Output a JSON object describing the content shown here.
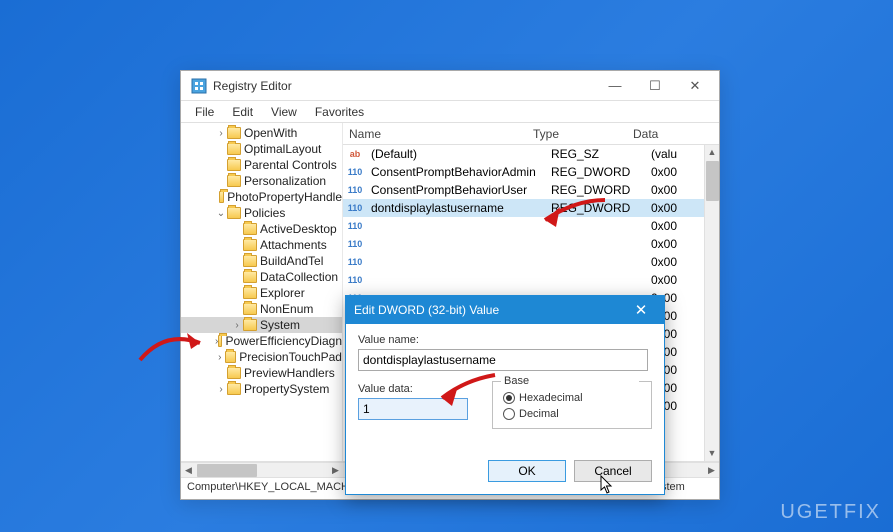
{
  "window": {
    "title": "Registry Editor",
    "menu": [
      "File",
      "Edit",
      "View",
      "Favorites"
    ],
    "status_path": "Computer\\HKEY_LOCAL_MACHINE\\SOFTWARE\\Microsoft\\Windows\\CurrentVersion\\Policies\\System"
  },
  "tree": {
    "items": [
      {
        "label": "OpenWith",
        "indent": 34,
        "arrow": ">"
      },
      {
        "label": "OptimalLayout",
        "indent": 34,
        "arrow": ""
      },
      {
        "label": "Parental Controls",
        "indent": 34,
        "arrow": ""
      },
      {
        "label": "Personalization",
        "indent": 34,
        "arrow": ""
      },
      {
        "label": "PhotoPropertyHandle",
        "indent": 34,
        "arrow": ""
      },
      {
        "label": "Policies",
        "indent": 34,
        "arrow": "v",
        "expanded": true
      },
      {
        "label": "ActiveDesktop",
        "indent": 50,
        "arrow": ""
      },
      {
        "label": "Attachments",
        "indent": 50,
        "arrow": ""
      },
      {
        "label": "BuildAndTel",
        "indent": 50,
        "arrow": ""
      },
      {
        "label": "DataCollection",
        "indent": 50,
        "arrow": ""
      },
      {
        "label": "Explorer",
        "indent": 50,
        "arrow": ""
      },
      {
        "label": "NonEnum",
        "indent": 50,
        "arrow": ""
      },
      {
        "label": "System",
        "indent": 50,
        "arrow": ">",
        "selected": true
      },
      {
        "label": "PowerEfficiencyDiagn",
        "indent": 34,
        "arrow": ">"
      },
      {
        "label": "PrecisionTouchPad",
        "indent": 34,
        "arrow": ">"
      },
      {
        "label": "PreviewHandlers",
        "indent": 34,
        "arrow": ""
      },
      {
        "label": "PropertySystem",
        "indent": 34,
        "arrow": ">"
      }
    ]
  },
  "list": {
    "headers": {
      "name": "Name",
      "type": "Type",
      "data": "Data"
    },
    "rows": [
      {
        "icon": "sz",
        "name": "(Default)",
        "type": "REG_SZ",
        "data": "(valu"
      },
      {
        "icon": "dw",
        "name": "ConsentPromptBehaviorAdmin",
        "type": "REG_DWORD",
        "data": "0x00"
      },
      {
        "icon": "dw",
        "name": "ConsentPromptBehaviorUser",
        "type": "REG_DWORD",
        "data": "0x00"
      },
      {
        "icon": "dw",
        "name": "dontdisplaylastusername",
        "type": "REG_DWORD",
        "data": "0x00",
        "selected": true
      },
      {
        "icon": "dw",
        "name": "",
        "type": "",
        "data": "0x00"
      },
      {
        "icon": "dw",
        "name": "",
        "type": "",
        "data": "0x00"
      },
      {
        "icon": "dw",
        "name": "",
        "type": "",
        "data": "0x00"
      },
      {
        "icon": "dw",
        "name": "",
        "type": "",
        "data": "0x00"
      },
      {
        "icon": "dw",
        "name": "",
        "type": "",
        "data": "0x00"
      },
      {
        "icon": "dw",
        "name": "",
        "type": "",
        "data": "0x00"
      },
      {
        "icon": "dw",
        "name": "",
        "type": "",
        "data": "0x00"
      },
      {
        "icon": "dw",
        "name": "",
        "type": "",
        "data": "0x00"
      },
      {
        "icon": "dw",
        "name": "",
        "type": "",
        "data": "0x00"
      },
      {
        "icon": "dw",
        "name": "",
        "type": "",
        "data": "0x00"
      },
      {
        "icon": "dw",
        "name": "",
        "type": "",
        "data": "0x00"
      }
    ]
  },
  "dialog": {
    "title": "Edit DWORD (32-bit) Value",
    "value_name_label": "Value name:",
    "value_name": "dontdisplaylastusername",
    "value_data_label": "Value data:",
    "value_data": "1",
    "base_label": "Base",
    "hex_label": "Hexadecimal",
    "dec_label": "Decimal",
    "ok": "OK",
    "cancel": "Cancel"
  },
  "watermark": "UGETFIX"
}
